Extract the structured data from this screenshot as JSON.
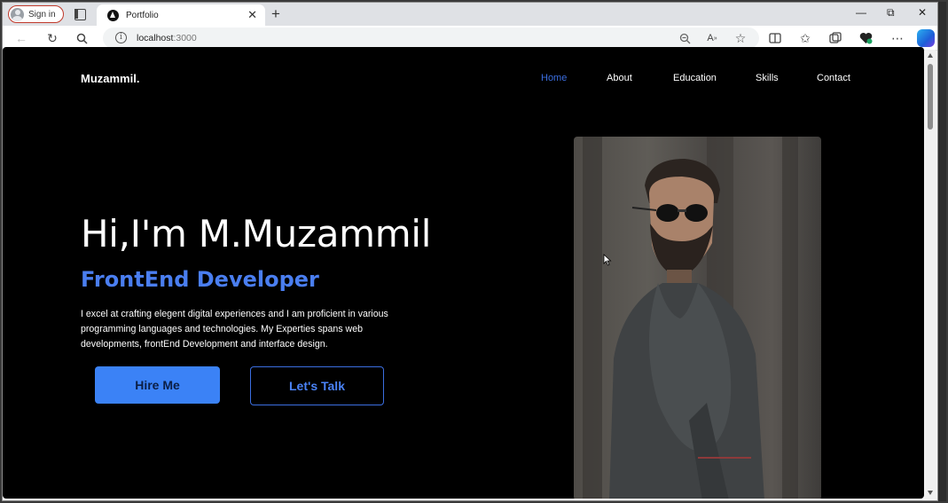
{
  "browser": {
    "signin_label": "Sign in",
    "tab_title": "Portfolio",
    "tab_close": "✕",
    "new_tab": "+",
    "url_host": "localhost",
    "url_port": ":3000",
    "window_minimize": "—",
    "window_restore": "⧉",
    "window_close": "✕"
  },
  "site": {
    "brand": "Muzammil.",
    "nav": [
      {
        "label": "Home",
        "active": true
      },
      {
        "label": "About",
        "active": false
      },
      {
        "label": "Education",
        "active": false
      },
      {
        "label": "Skills",
        "active": false
      },
      {
        "label": "Contact",
        "active": false
      }
    ],
    "hero": {
      "title": "Hi,I'm M.Muzammil",
      "role": "FrontEnd Developer",
      "description": "I excel at crafting elegent digital experiences and I am proficient in various programming languages and technologies. My Experties spans web developments, frontEnd Development and interface design.",
      "hire_button": "Hire Me",
      "talk_button": "Let's Talk"
    }
  },
  "colors": {
    "accent": "#3b82f6",
    "nav_active": "#3b6ee0",
    "role_text": "#4a7ef0",
    "page_bg": "#000000"
  }
}
